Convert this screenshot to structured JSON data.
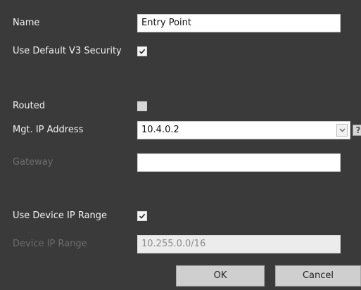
{
  "form": {
    "name": {
      "label": "Name",
      "value": "Entry Point"
    },
    "use_default_v3_security": {
      "label": "Use Default V3 Security",
      "checked": true
    },
    "routed": {
      "label": "Routed",
      "checked": false
    },
    "mgt_ip_address": {
      "label": "Mgt. IP Address",
      "value": "10.4.0.2",
      "help_glyph": "?"
    },
    "gateway": {
      "label": "Gateway",
      "value": ""
    },
    "use_device_ip_range": {
      "label": "Use Device IP Range",
      "checked": true
    },
    "device_ip_range": {
      "label": "Device IP Range",
      "value": "10.255.0.0/16"
    }
  },
  "buttons": {
    "ok": "OK",
    "cancel": "Cancel"
  },
  "icons": {
    "dropdown": "chevron-down-icon",
    "help": "help-icon",
    "checkmark": "checkmark-icon"
  },
  "colors": {
    "background": "#3a3a3a",
    "disabled_text": "#6e6e6e"
  }
}
